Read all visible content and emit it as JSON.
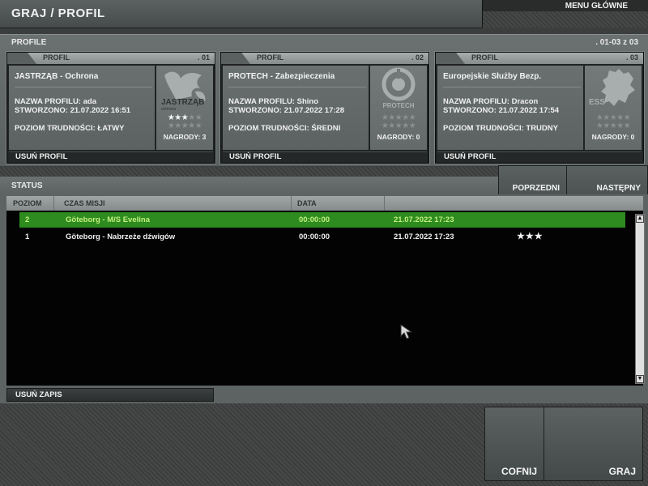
{
  "header": {
    "title": "GRAJ / PROFIL",
    "menu_label": "MENU GŁÓWNE"
  },
  "profiles": {
    "section_title": "PROFILE",
    "page_indicator": ". 01-03 z 03",
    "cards": [
      {
        "tab_label": "PROFIL",
        "number": ". 01",
        "name_prefix": "JASTRZĄB",
        "name_suffix": " - Ochrona",
        "profile_name_line": "NAZWA PROFILU: ada",
        "created_line": "STWORZONO: 21.07.2022 16:51",
        "difficulty_line": "POZIOM TRUDNOŚCI: ŁATWY",
        "awards": "NAGRODY: 3",
        "awards_count": 3,
        "logo_text": "JASTRZĄB",
        "logo_subtext": "ochrona",
        "logo_icon": "hawk-logo-icon",
        "delete_label": "USUŃ PROFIL"
      },
      {
        "tab_label": "PROFIL",
        "number": ". 02",
        "name_prefix": "PROTECH",
        "name_suffix": " - Zabezpieczenia",
        "profile_name_line": "NAZWA PROFILU: Shino",
        "created_line": "STWORZONO: 21.07.2022 17:28",
        "difficulty_line": "POZIOM TRUDNOŚCI: ŚREDNI",
        "awards": "NAGRODY: 0",
        "awards_count": 0,
        "logo_text": "PROTECH",
        "logo_icon": "protech-logo-icon",
        "delete_label": "USUŃ PROFIL"
      },
      {
        "tab_label": "PROFIL",
        "number": ". 03",
        "name_prefix": "Europejskie Służby Bezp.",
        "name_suffix": "",
        "profile_name_line": "NAZWA PROFILU: Dracon",
        "created_line": "STWORZONO: 21.07.2022 17:54",
        "difficulty_line": "POZIOM TRUDNOŚCI: TRUDNY",
        "awards": "NAGRODY: 0",
        "awards_count": 0,
        "logo_text": "ESS",
        "logo_icon": "europe-map-logo-icon",
        "delete_label": "USUŃ PROFIL"
      }
    ]
  },
  "status": {
    "section_title": "STATUS",
    "prev_label": "POPRZEDNI",
    "next_label": "NASTĘPNY",
    "columns": [
      "POZIOM",
      "CZAS MISJI",
      "DATA",
      ""
    ],
    "rows": [
      {
        "level": "2",
        "mission": "Göteborg - M/S Evelina",
        "time": "00:00:00",
        "date": "21.07.2022 17:23",
        "stars": "",
        "selected": true
      },
      {
        "level": "1",
        "mission": "Göteborg - Nabrzeże dźwigów",
        "time": "00:00:00",
        "date": "21.07.2022 17:23",
        "stars": "★★★",
        "selected": false
      }
    ],
    "delete_save_label": "USUŃ ZAPIS"
  },
  "footer": {
    "back_label": "COFNIJ",
    "play_label": "GRAJ"
  },
  "colors": {
    "selected_row": "#2d8b1f",
    "selected_text": "#c4f080",
    "background": "#3c3e3e"
  }
}
